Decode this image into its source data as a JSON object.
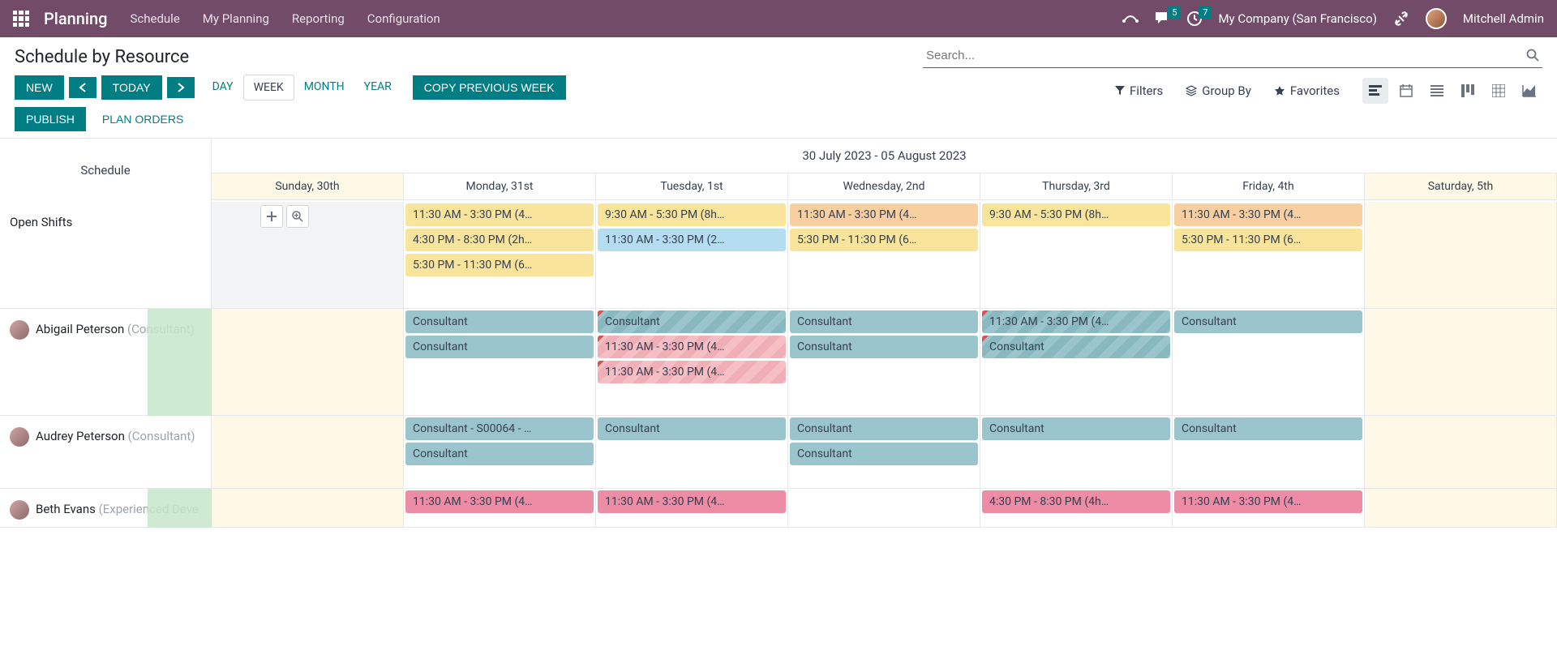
{
  "topnav": {
    "brand": "Planning",
    "menu": [
      "Schedule",
      "My Planning",
      "Reporting",
      "Configuration"
    ],
    "messages_badge": "5",
    "activities_badge": "7",
    "company": "My Company (San Francisco)",
    "user": "Mitchell Admin"
  },
  "controls": {
    "page_title": "Schedule by Resource",
    "search_placeholder": "Search...",
    "btn_new": "NEW",
    "btn_today": "TODAY",
    "btn_publish": "PUBLISH",
    "btn_plan_orders": "PLAN ORDERS",
    "btn_copy": "COPY PREVIOUS WEEK",
    "scales": {
      "day": "DAY",
      "week": "WEEK",
      "month": "MONTH",
      "year": "YEAR"
    },
    "filters_label": "Filters",
    "groupby_label": "Group By",
    "favorites_label": "Favorites"
  },
  "gantt": {
    "left_header": "Schedule",
    "date_range": "30 July 2023 - 05 August 2023",
    "days": [
      "Sunday, 30th",
      "Monday, 31st",
      "Tuesday, 1st",
      "Wednesday, 2nd",
      "Thursday, 3rd",
      "Friday, 4th",
      "Saturday, 5th"
    ],
    "rows": [
      {
        "name": "Open Shifts",
        "role": "",
        "has_avatar": false,
        "hover": true,
        "cells": [
          [],
          [
            {
              "label": "11:30 AM - 3:30 PM (4…",
              "cls": "pill-yellow"
            },
            {
              "label": "4:30 PM - 8:30 PM (2h…",
              "cls": "pill-yellow"
            },
            {
              "label": "5:30 PM - 11:30 PM (6…",
              "cls": "pill-yellow"
            }
          ],
          [
            {
              "label": "9:30 AM - 5:30 PM (8h…",
              "cls": "pill-yellow"
            },
            {
              "label": "11:30 AM - 3:30 PM (2…",
              "cls": "pill-blue"
            }
          ],
          [
            {
              "label": "11:30 AM - 3:30 PM (4…",
              "cls": "pill-orange"
            },
            {
              "label": "5:30 PM - 11:30 PM (6…",
              "cls": "pill-yellow"
            }
          ],
          [
            {
              "label": "9:30 AM - 5:30 PM (8h…",
              "cls": "pill-yellow"
            }
          ],
          [
            {
              "label": "11:30 AM - 3:30 PM (4…",
              "cls": "pill-orange"
            },
            {
              "label": "5:30 PM - 11:30 PM (6…",
              "cls": "pill-yellow"
            }
          ],
          []
        ]
      },
      {
        "name": "Abigail Peterson",
        "role": "(Consultant)",
        "has_avatar": true,
        "green_left": true,
        "cells": [
          [],
          [
            {
              "label": "Consultant",
              "cls": "pill-teal"
            },
            {
              "label": "Consultant",
              "cls": "pill-teal"
            }
          ],
          [
            {
              "label": "Consultant",
              "cls": "pill-teal-stripe corner-red"
            },
            {
              "label": "11:30 AM - 3:30 PM (4…",
              "cls": "pill-pink-stripe corner-red"
            },
            {
              "label": "11:30 AM - 3:30 PM (4…",
              "cls": "pill-pink-stripe corner-red"
            }
          ],
          [
            {
              "label": "Consultant",
              "cls": "pill-teal"
            },
            {
              "label": "Consultant",
              "cls": "pill-teal"
            }
          ],
          [
            {
              "label": "11:30 AM - 3:30 PM (4…",
              "cls": "pill-teal-stripe corner-red"
            },
            {
              "label": "Consultant",
              "cls": "pill-teal-stripe corner-red"
            }
          ],
          [
            {
              "label": "Consultant",
              "cls": "pill-teal"
            }
          ],
          []
        ]
      },
      {
        "name": "Audrey Peterson",
        "role": "(Consultant)",
        "has_avatar": true,
        "cells": [
          [],
          [
            {
              "label": "Consultant - S00064 - …",
              "cls": "pill-teal"
            },
            {
              "label": "Consultant",
              "cls": "pill-teal"
            }
          ],
          [
            {
              "label": "Consultant",
              "cls": "pill-teal"
            }
          ],
          [
            {
              "label": "Consultant",
              "cls": "pill-teal"
            },
            {
              "label": "Consultant",
              "cls": "pill-teal"
            }
          ],
          [
            {
              "label": "Consultant",
              "cls": "pill-teal"
            }
          ],
          [
            {
              "label": "Consultant",
              "cls": "pill-teal"
            }
          ],
          []
        ]
      },
      {
        "name": "Beth Evans",
        "role": "(Experienced Deve",
        "has_avatar": true,
        "green_left": true,
        "cells": [
          [],
          [
            {
              "label": "11:30 AM - 3:30 PM (4…",
              "cls": "pill-pink-solid"
            }
          ],
          [
            {
              "label": "11:30 AM - 3:30 PM (4…",
              "cls": "pill-pink-solid"
            }
          ],
          [],
          [
            {
              "label": "4:30 PM - 8:30 PM (4h…",
              "cls": "pill-pink-solid"
            }
          ],
          [
            {
              "label": "11:30 AM - 3:30 PM (4…",
              "cls": "pill-pink-solid"
            }
          ],
          []
        ]
      }
    ]
  }
}
